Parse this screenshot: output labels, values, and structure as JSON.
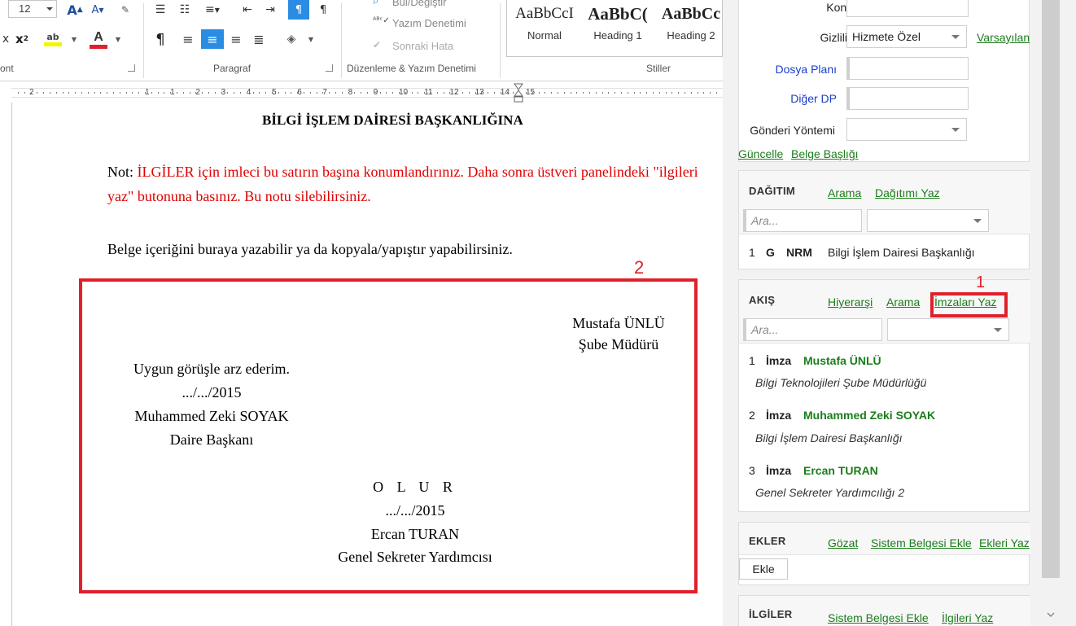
{
  "ribbon": {
    "font_size": "12",
    "groups": {
      "font_label": "ont",
      "paragraph_label": "Paragraf",
      "editing_label": "Düzenleme & Yazım Denetimi",
      "styles_label": "Stiller"
    },
    "editing": {
      "find_replace": "Bul/Değiştir",
      "spell_check": "Yazım Denetimi",
      "next_error": "Sonraki Hata"
    },
    "styles": [
      {
        "sample": "AaBbCcI",
        "name": "Normal"
      },
      {
        "sample": "AaBbC(",
        "name": "Heading 1"
      },
      {
        "sample": "AaBbCc",
        "name": "Heading 2"
      }
    ]
  },
  "ruler": {
    "numbers": [
      "2",
      "1",
      "1",
      "2",
      "3",
      "4",
      "5",
      "6",
      "7",
      "8",
      "9",
      "10",
      "11",
      "12",
      "13",
      "14",
      "15"
    ]
  },
  "document": {
    "heading": "BİLGİ İŞLEM DAİRESİ BAŞKANLIĞINA",
    "note_prefix": "Not: ",
    "note_red": "İLGİLER için imleci bu satırın başına konumlandırınız. Daha sonra üstveri panelindeki \"ilgileri yaz\" butonuna basınız. Bu notu silebilirsiniz.",
    "body_line": "Belge içeriğini buraya yazabilir ya da kopyala/yapıştır yapabilirsiniz.",
    "marker_2": "2",
    "sig1": {
      "name": "Mustafa ÜNLÜ",
      "title": "Şube Müdürü"
    },
    "sig2": {
      "line1": "Uygun görüşle arz ederim.",
      "date": ".../.../2015",
      "name": "Muhammed Zeki SOYAK",
      "title": "Daire Başkanı"
    },
    "sig3": {
      "olur": "O L U R",
      "date": ".../.../2015",
      "name": "Ercan TURAN",
      "title": "Genel Sekreter Yardımcısı"
    }
  },
  "pane": {
    "konu_label": "Konu",
    "gizlilik_label": "Gizlilik",
    "gizlilik_value": "Hizmete Özel",
    "varsayilan_link": "Varsayılan",
    "dosya_plani_label": "Dosya Planı",
    "diger_dp_label": "Diğer DP",
    "gonderi_label": "Gönderi Yöntemi",
    "guncelle_link": "Güncelle",
    "belge_basligi_link": "Belge Başlığı",
    "dagitim": {
      "title": "DAĞITIM",
      "arama_link": "Arama",
      "dagitimi_yaz_link": "Dağıtımı Yaz",
      "search_placeholder": "Ara...",
      "row": {
        "num": "1",
        "code1": "G",
        "code2": "NRM",
        "text": "Bilgi İşlem Dairesi Başkanlığı"
      }
    },
    "akis": {
      "title": "AKIŞ",
      "hiyerarsi_link": "Hiyerarşi",
      "arama_link": "Arama",
      "imzalari_yaz_link": "İmzaları Yaz",
      "marker_1": "1",
      "search_placeholder": "Ara...",
      "items": [
        {
          "num": "1",
          "type": "İmza",
          "name": "Mustafa ÜNLÜ",
          "unit": "Bilgi Teknolojileri Şube Müdürlüğü"
        },
        {
          "num": "2",
          "type": "İmza",
          "name": "Muhammed Zeki SOYAK",
          "unit": "Bilgi İşlem Dairesi Başkanlığı"
        },
        {
          "num": "3",
          "type": "İmza",
          "name": "Ercan TURAN",
          "unit": "Genel Sekreter Yardımcılığı 2"
        }
      ]
    },
    "ekler": {
      "title": "EKLER",
      "gozat_link": "Gözat",
      "sistem_belgesi_link": "Sistem Belgesi Ekle",
      "ekleri_yaz_link": "Ekleri Yaz",
      "ekle_button": "Ekle"
    },
    "ilgiler": {
      "title": "İLGİLER",
      "sistem_belgesi_link": "Sistem Belgesi Ekle",
      "ilgileri_yaz_link": "İlgileri Yaz"
    }
  },
  "colors": {
    "highlight_red": "#e0202a",
    "link_green": "#1b7d1b",
    "label_blue": "#1a3ec8",
    "active_blue": "#2b8ce3"
  }
}
